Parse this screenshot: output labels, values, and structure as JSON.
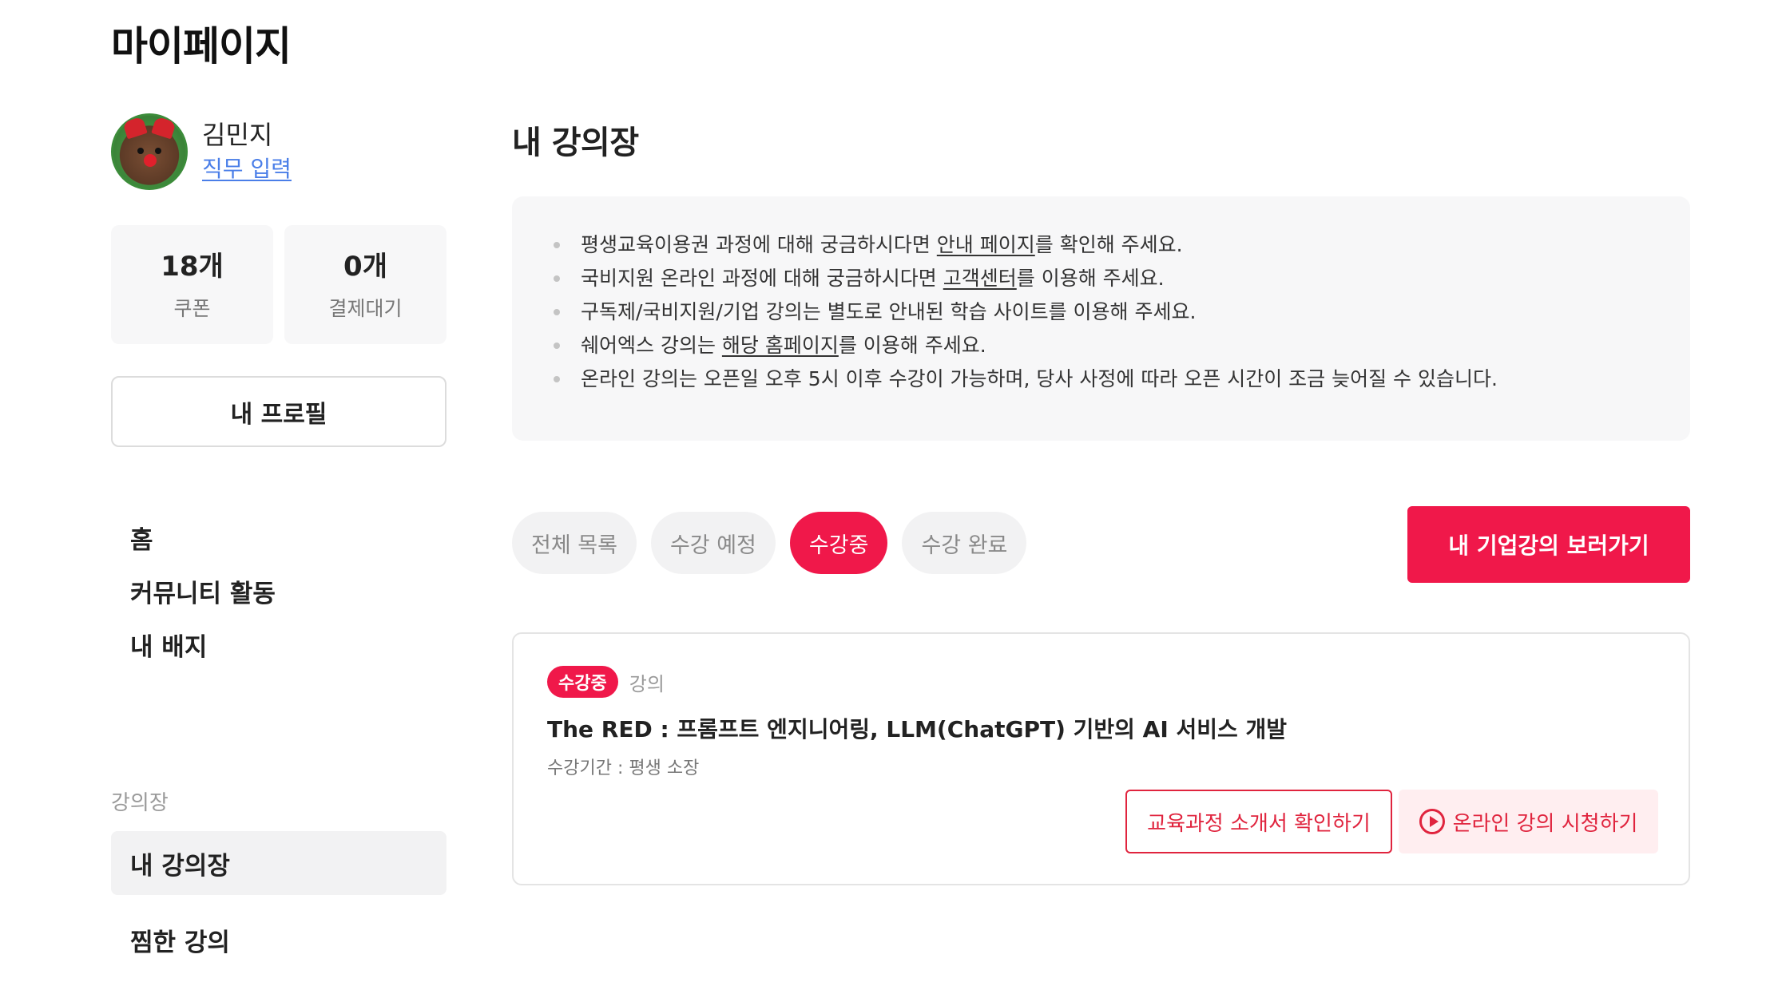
{
  "page": {
    "title": "마이페이지"
  },
  "profile": {
    "name": "김민지",
    "job_link": "직무 입력",
    "avatar_icon": "reindeer-avatar"
  },
  "stats": [
    {
      "value": "18개",
      "label": "쿠폰"
    },
    {
      "value": "0개",
      "label": "결제대기"
    }
  ],
  "profile_button": "내 프로필",
  "nav": {
    "items": [
      "홈",
      "커뮤니티 활동",
      "내 배지"
    ],
    "section_label": "강의장",
    "section_items": [
      "내 강의장",
      "찜한 강의"
    ],
    "active": "내 강의장"
  },
  "main": {
    "title": "내 강의장",
    "notices": {
      "n0_pre": "평생교육이용권 과정에 대해 궁금하시다면 ",
      "n0_link": "안내 페이지",
      "n0_post": "를 확인해 주세요.",
      "n1_pre": "국비지원 온라인 과정에 대해 궁금하시다면 ",
      "n1_link": "고객센터",
      "n1_post": "를 이용해 주세요.",
      "n2": "구독제/국비지원/기업 강의는 별도로 안내된 학습 사이트를 이용해 주세요.",
      "n3_pre": "쉐어엑스 강의는 ",
      "n3_link": "해당 홈페이지",
      "n3_post": "를 이용해 주세요.",
      "n4": "온라인 강의는 오픈일 오후 5시 이후 수강이 가능하며, 당사 사정에 따라 오픈 시간이 조금 늦어질 수 있습니다."
    },
    "tabs": [
      "전체 목록",
      "수강 예정",
      "수강중",
      "수강 완료"
    ],
    "active_tab": "수강중",
    "corp_button": "내 기업강의 보러가기"
  },
  "course": {
    "status_badge": "수강중",
    "type": "강의",
    "title": "The RED : 프롬프트 엔지니어링, LLM(ChatGPT) 기반의 AI 서비스 개발",
    "period": "수강기간 : 평생 소장",
    "intro_button": "교육과정 소개서 확인하기",
    "watch_button": "온라인 강의 시청하기"
  },
  "colors": {
    "accent": "#f0184a",
    "link": "#4a7ee8",
    "panel_bg": "#f7f7f8"
  }
}
